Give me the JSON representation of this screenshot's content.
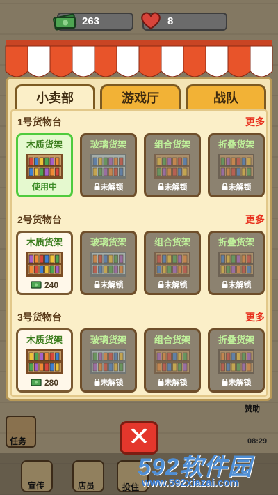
{
  "stats": {
    "cash": "263",
    "hearts": "8"
  },
  "tabs": [
    {
      "label": "小卖部",
      "active": true
    },
    {
      "label": "游戏厅",
      "active": false
    },
    {
      "label": "战队",
      "active": false
    }
  ],
  "stands": [
    {
      "title": "1号货物台",
      "more": "更多",
      "items": [
        {
          "name": "木质货架",
          "status": "使用中",
          "state": "selected"
        },
        {
          "name": "玻璃货架",
          "status": "未解锁",
          "state": "locked"
        },
        {
          "name": "组合货架",
          "status": "未解锁",
          "state": "locked"
        },
        {
          "name": "折叠货架",
          "status": "未解锁",
          "state": "locked"
        }
      ]
    },
    {
      "title": "2号货物台",
      "more": "更多",
      "items": [
        {
          "name": "木质货架",
          "price": "240",
          "state": "unlocked"
        },
        {
          "name": "玻璃货架",
          "status": "未解锁",
          "state": "locked"
        },
        {
          "name": "组合货架",
          "status": "未解锁",
          "state": "locked"
        },
        {
          "name": "折叠货架",
          "status": "未解锁",
          "state": "locked"
        }
      ]
    },
    {
      "title": "3号货物台",
      "more": "更多",
      "items": [
        {
          "name": "木质货架",
          "price": "280",
          "state": "unlocked"
        },
        {
          "name": "玻璃货架",
          "status": "未解锁",
          "state": "locked"
        },
        {
          "name": "组合货架",
          "status": "未解锁",
          "state": "locked"
        },
        {
          "name": "折叠货架",
          "status": "未解锁",
          "state": "locked"
        }
      ]
    }
  ],
  "close_label": "✕",
  "hud": {
    "task": "任务",
    "help": "赞助",
    "time": "08:29",
    "promo": "宣传",
    "staff": "店员",
    "invest": "投住"
  },
  "watermark": {
    "logo": "592软件园",
    "url": "www.592xiazai.com"
  },
  "colors": {
    "awning_red": "#e8542a",
    "tab_orange": "#f2b236",
    "more_red": "#e8311e",
    "selected_green": "#4fcb3d"
  },
  "icons": {
    "cash": "cash-icon",
    "heart": "heart-icon",
    "lock": "lock-icon",
    "close": "close-icon"
  }
}
